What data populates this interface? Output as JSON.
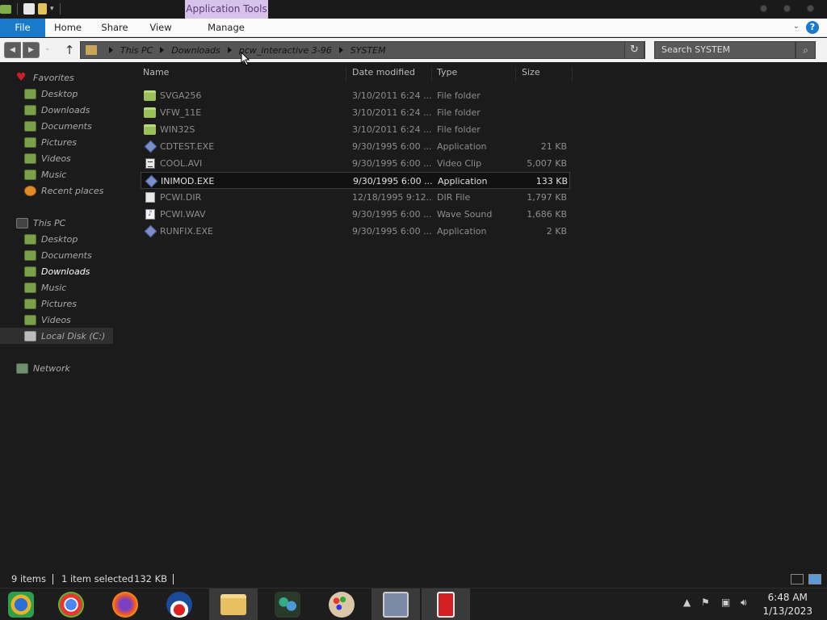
{
  "ribbon": {
    "contextual_tab": "Application Tools",
    "tabs": [
      "File",
      "Home",
      "Share",
      "View",
      "Manage"
    ]
  },
  "address": {
    "crumbs": [
      "This PC",
      "Downloads",
      "pcw_interactive 3-96",
      "SYSTEM"
    ]
  },
  "search": {
    "placeholder": "Search SYSTEM"
  },
  "navigation": {
    "favorites_header": "Favorites",
    "favorites": [
      "Desktop",
      "Downloads",
      "Documents",
      "Pictures",
      "Videos",
      "Music",
      "Recent places"
    ],
    "this_pc_header": "This PC",
    "this_pc": [
      "Desktop",
      "Documents",
      "Downloads",
      "Music",
      "Pictures",
      "Videos",
      "Local Disk (C:)"
    ],
    "network": "Network",
    "selected": "Downloads"
  },
  "columns": {
    "name": "Name",
    "date": "Date modified",
    "type": "Type",
    "size": "Size"
  },
  "files": [
    {
      "name": "SVGA256",
      "date": "3/10/2011 6:24 ...",
      "type": "File folder",
      "size": "",
      "icon": "folder-icon"
    },
    {
      "name": "VFW_11E",
      "date": "3/10/2011 6:24 ...",
      "type": "File folder",
      "size": "",
      "icon": "folder-icon"
    },
    {
      "name": "WIN32S",
      "date": "3/10/2011 6:24 ...",
      "type": "File folder",
      "size": "",
      "icon": "folder-icon"
    },
    {
      "name": "CDTEST.EXE",
      "date": "9/30/1995 6:00 ...",
      "type": "Application",
      "size": "21 KB",
      "icon": "application-icon"
    },
    {
      "name": "COOL.AVI",
      "date": "9/30/1995 6:00 ...",
      "type": "Video Clip",
      "size": "5,007 KB",
      "icon": "video-file-icon"
    },
    {
      "name": "INIMOD.EXE",
      "date": "9/30/1995 6:00 ...",
      "type": "Application",
      "size": "133 KB",
      "icon": "application-icon"
    },
    {
      "name": "PCWI.DIR",
      "date": "12/18/1995 9:12...",
      "type": "DIR File",
      "size": "1,797 KB",
      "icon": "file-icon"
    },
    {
      "name": "PCWI.WAV",
      "date": "9/30/1995 6:00 ...",
      "type": "Wave Sound",
      "size": "1,686 KB",
      "icon": "audio-file-icon"
    },
    {
      "name": "RUNFIX.EXE",
      "date": "9/30/1995 6:00 ...",
      "type": "Application",
      "size": "2 KB",
      "icon": "application-icon"
    }
  ],
  "selected_file": "INIMOD.EXE",
  "status": {
    "items": "9 items",
    "selected": "1 item selected",
    "size": "132 KB"
  },
  "taskbar": {
    "apps": [
      "start-orb-icon",
      "chrome-icon",
      "firefox-icon",
      "obama-logo-icon",
      "file-explorer-icon",
      "network-people-icon",
      "paint-icon",
      "desktop-windows-icon",
      "red-app-icon"
    ],
    "clock_time": "6:48 AM",
    "clock_date": "1/13/2023"
  }
}
